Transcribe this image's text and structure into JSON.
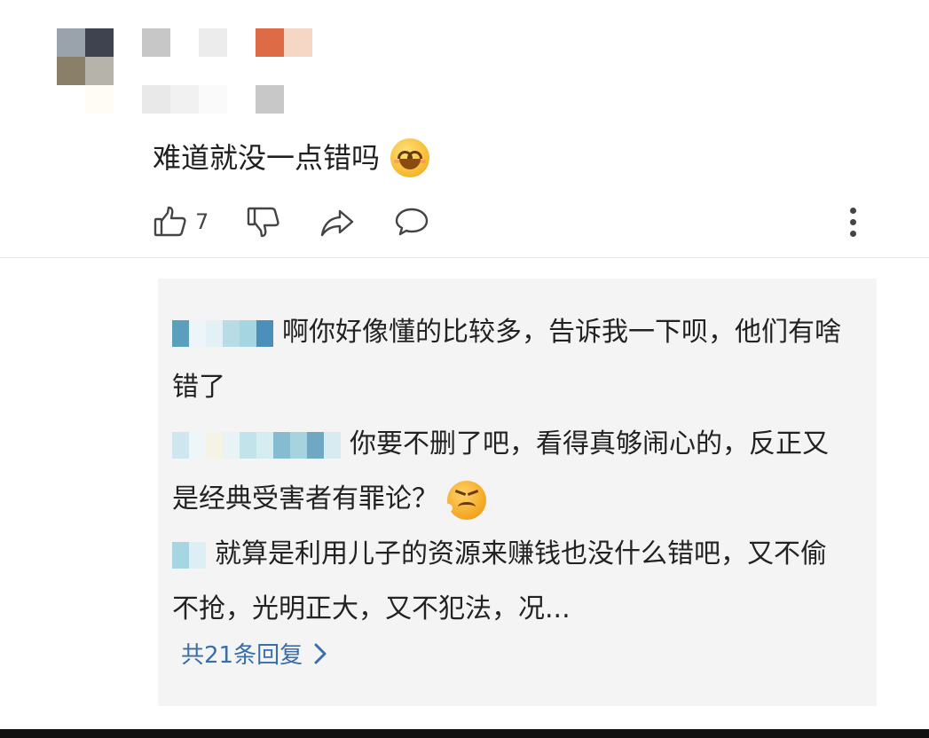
{
  "comment": {
    "avatar_colors": [
      "#9aa3ab",
      "#3f4350",
      "#8a7f69",
      "#b5b3aa",
      "#ffffff",
      "#fffbf5"
    ],
    "username_blur_colors": [
      "#c7c7c7",
      "#ffffff",
      "#ececec",
      "#ffffff",
      "#dd6b45",
      "#f6d6c4"
    ],
    "meta_blur_colors": [
      "#e9e9e9",
      "#f1f1f1",
      "#fafafa",
      "#ffffff",
      "#c8c8c8"
    ],
    "text": "难道就没一点错吗",
    "emoji_icon": "laughing-face-icon",
    "like_count": "7",
    "icons": {
      "like": "thumbs-up-icon",
      "dislike": "thumbs-down-icon",
      "share": "share-arrow-icon",
      "reply": "speech-bubble-icon",
      "more": "more-vertical-icon"
    }
  },
  "replies": [
    {
      "name_blur_colors": [
        "#5b9fbd",
        "#eef5f8",
        "#e3f1f6",
        "#b8dce6",
        "#a5d5e1",
        "#4b8fba"
      ],
      "text": "啊你好像懂的比较多，告诉我一下呗，他们有啥错了"
    },
    {
      "name_blur_colors": [
        "#cfe6ee",
        "#eef6f8",
        "#f5f3e6",
        "#e9f3f6",
        "#c3e3ea",
        "#d5ecf1",
        "#86bcd0",
        "#a6d3dd",
        "#6ea8c2",
        "#d7ebf0"
      ],
      "text": "你要不删了吧，看得真够闹心的，反正又是经典受害者有罪论？",
      "emoji_icon": "angry-steaming-face-icon"
    },
    {
      "name_blur_colors": [
        "#a7d6e3",
        "#ddeef4"
      ],
      "text": "就算是利用儿子的资源来赚钱也没什么错吧，又不偷不抢，光明正大，又不犯法，况..."
    }
  ],
  "view_more": {
    "label": "共21条回复",
    "icon": "chevron-right-icon",
    "color": "#3a6ea8"
  }
}
